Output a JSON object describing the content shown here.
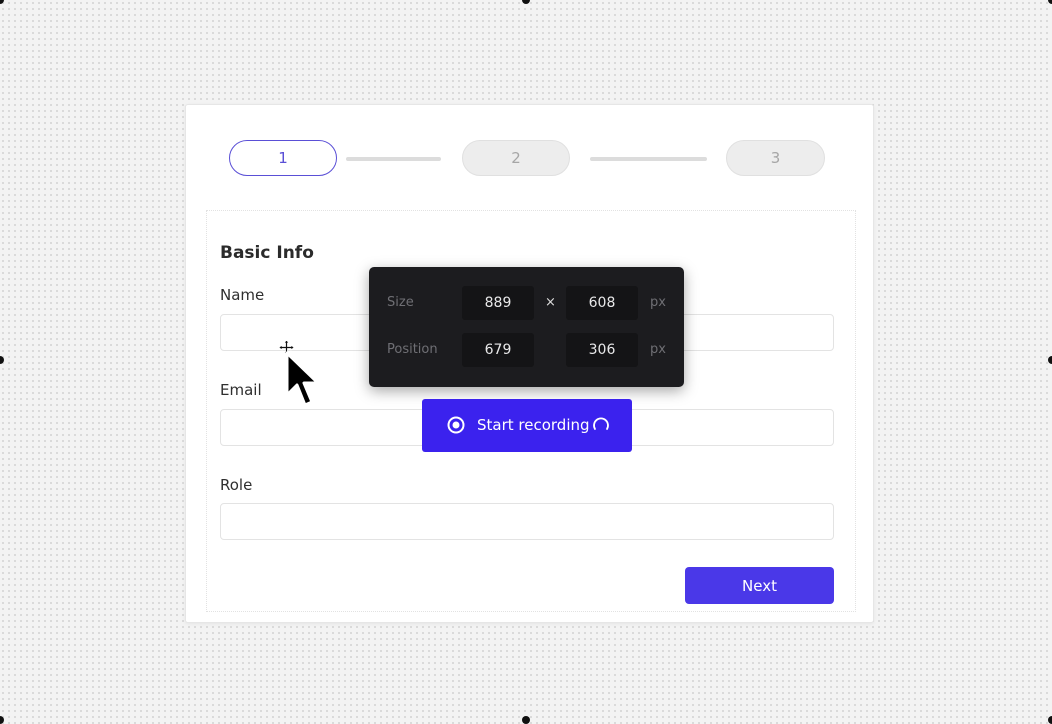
{
  "stepper": {
    "steps": [
      {
        "label": "1",
        "state": "active"
      },
      {
        "label": "2",
        "state": "inactive"
      },
      {
        "label": "3",
        "state": "inactive"
      }
    ]
  },
  "form": {
    "section_title": "Basic Info",
    "fields": [
      {
        "label": "Name",
        "value": "",
        "placeholder": ""
      },
      {
        "label": "Email",
        "value": "",
        "placeholder": ""
      },
      {
        "label": "Role",
        "value": "",
        "placeholder": ""
      }
    ],
    "next_label": "Next"
  },
  "dimension_panel": {
    "size_label": "Size",
    "width": "889",
    "times": "×",
    "height": "608",
    "position_label": "Position",
    "x": "679",
    "y": "306",
    "unit": "px"
  },
  "recording": {
    "label": "Start recording",
    "icon": "record-icon",
    "status_icon": "spinner-icon"
  },
  "cursors": [
    "move-cursor-icon",
    "arrow-cursor-icon"
  ],
  "colors": {
    "accent": "#4a38e8",
    "record_button": "#3b22ee",
    "active_step": "#5a4fd6",
    "panel_bg": "#1c1c1f"
  }
}
